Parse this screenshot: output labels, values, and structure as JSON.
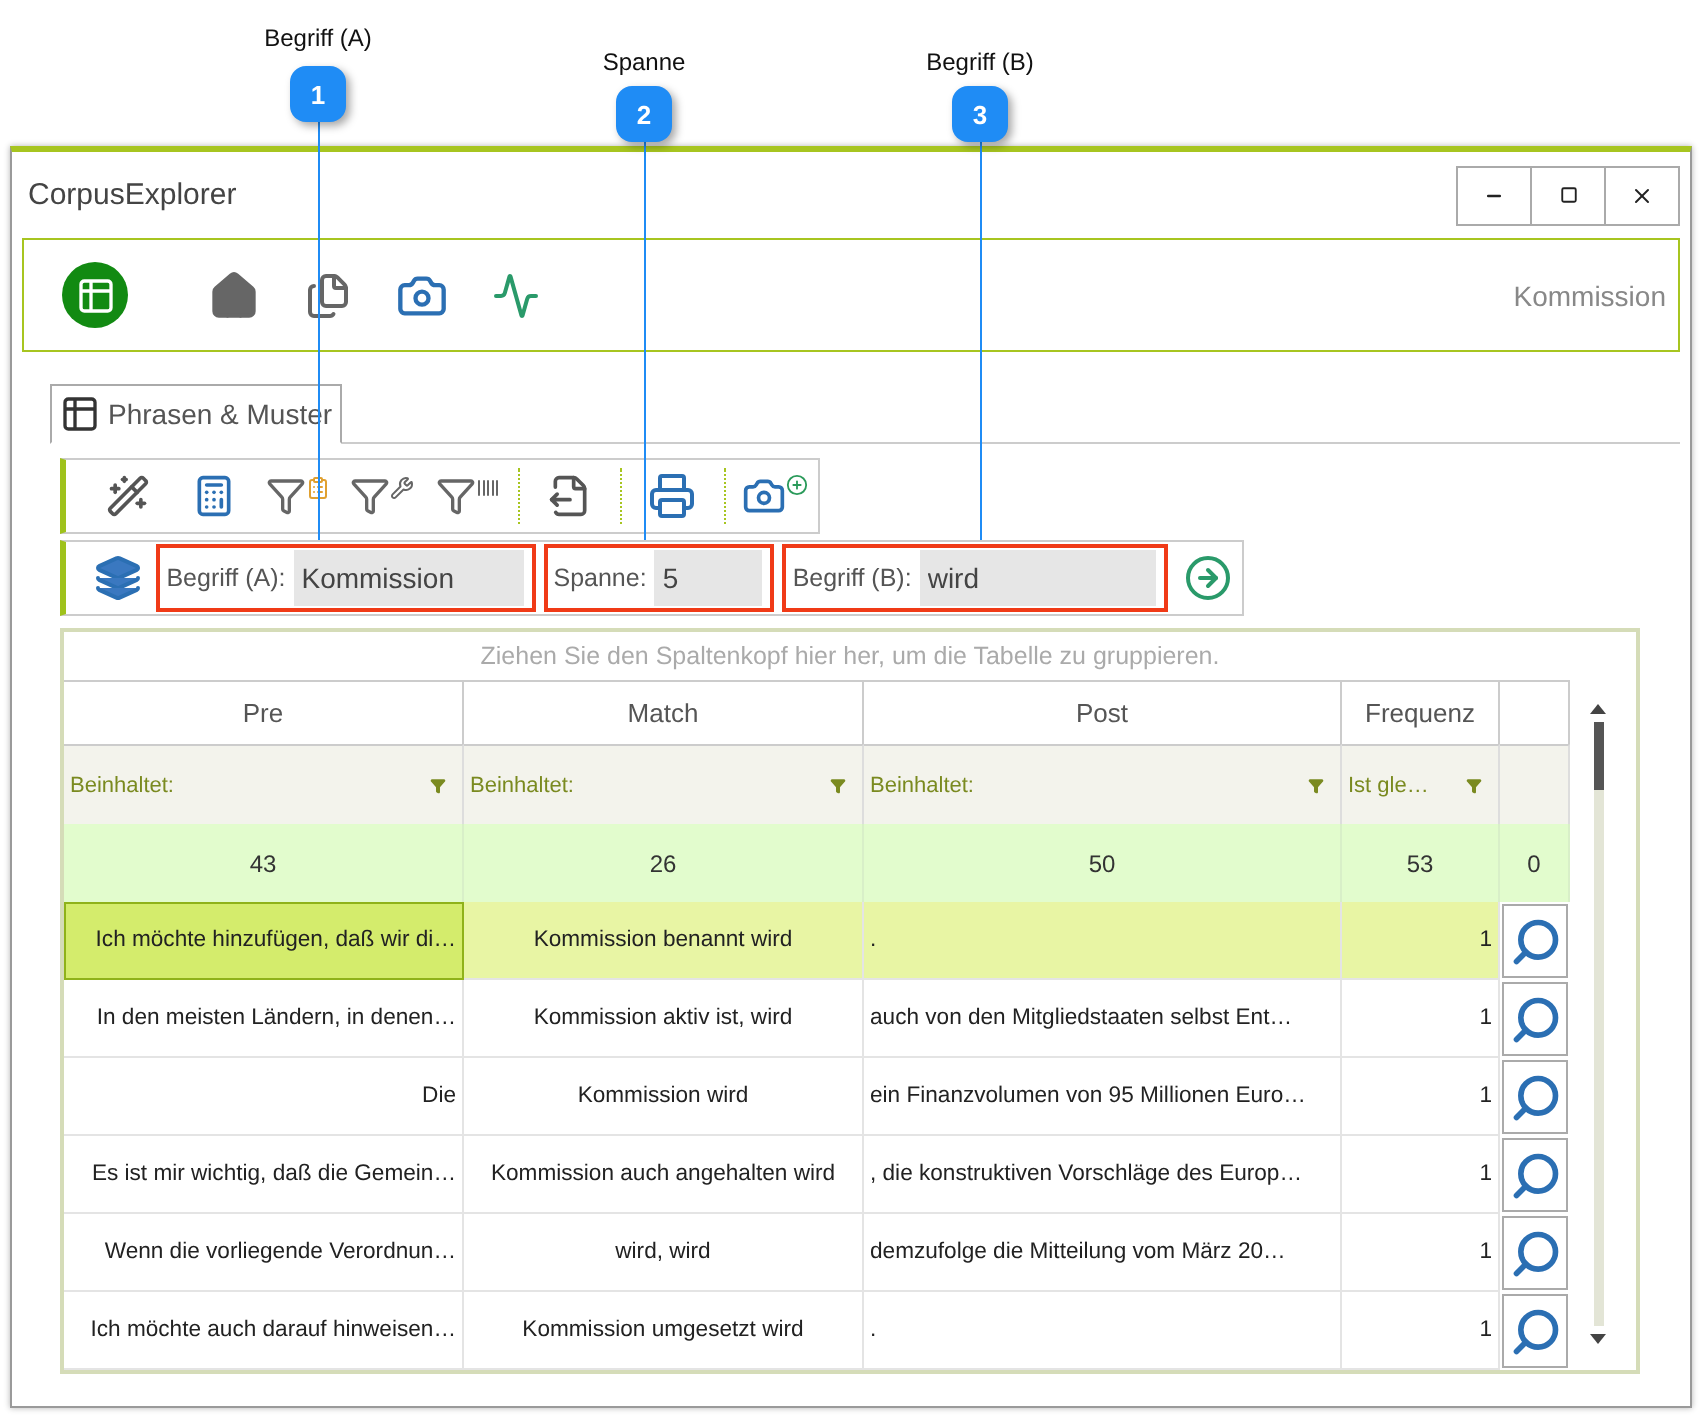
{
  "callouts": [
    {
      "number": "1",
      "label": "Begriff (A)"
    },
    {
      "number": "2",
      "label": "Spanne"
    },
    {
      "number": "3",
      "label": "Begriff (B)"
    }
  ],
  "window": {
    "title": "CorpusExplorer"
  },
  "nav": {
    "breadcrumb": "Kommission"
  },
  "tabs": [
    {
      "label": "Phrasen & Muster",
      "selected": true
    }
  ],
  "search": {
    "fields": [
      {
        "label": "Begriff (A):",
        "value": "Kommission",
        "highlighted": true
      },
      {
        "label": "Spanne:",
        "value": "5",
        "highlighted": true
      },
      {
        "label": "Begriff (B):",
        "value": "wird",
        "highlighted": true
      }
    ]
  },
  "table": {
    "group_hint": "Ziehen Sie den Spaltenkopf hier her, um die Tabelle zu gruppieren.",
    "columns": [
      {
        "name": "Pre",
        "filter": "Beinhaltet:"
      },
      {
        "name": "Match",
        "filter": "Beinhaltet:"
      },
      {
        "name": "Post",
        "filter": "Beinhaltet:"
      },
      {
        "name": "Frequenz",
        "filter": "Ist gle…"
      }
    ],
    "summary": [
      "43",
      "26",
      "50",
      "53",
      "0"
    ],
    "rows": [
      {
        "cells": [
          "Ich möchte hinzufügen, daß wir di…",
          "Kommission benannt wird",
          ".",
          "1"
        ],
        "selected": true
      },
      {
        "cells": [
          "In den meisten Ländern, in denen…",
          "Kommission aktiv ist, wird",
          "auch von den Mitgliedstaaten selbst Ent…",
          "1"
        ],
        "selected": false
      },
      {
        "cells": [
          "Die",
          "Kommission wird",
          "ein Finanzvolumen von 95 Millionen Euro…",
          "1"
        ],
        "selected": false
      },
      {
        "cells": [
          "Es ist mir wichtig, daß die Gemein…",
          "Kommission auch angehalten wird",
          ", die konstruktiven Vorschläge des Europ…",
          "1"
        ],
        "selected": false
      },
      {
        "cells": [
          "Wenn die vorliegende Verordnun…",
          "wird, wird",
          "demzufolge die Mitteilung vom März 20…",
          "1"
        ],
        "selected": false
      },
      {
        "cells": [
          "Ich möchte auch darauf hinweisen…",
          "Kommission umgesetzt wird",
          ".",
          "1"
        ],
        "selected": false
      }
    ]
  }
}
